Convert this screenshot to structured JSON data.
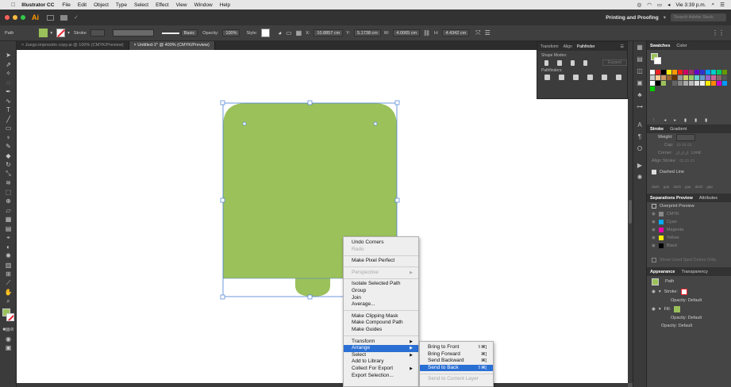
{
  "menubar": {
    "apple": "",
    "app_name": "Illustrator CC",
    "items": [
      "File",
      "Edit",
      "Object",
      "Type",
      "Select",
      "Effect",
      "View",
      "Window",
      "Help"
    ],
    "clock": "Vie 3:39 p.m."
  },
  "appbar": {
    "logo": "Ai",
    "workspace": "Printing and Proofing",
    "search_placeholder": "Search Adobe Stock"
  },
  "control_bar": {
    "selection_label": "Path",
    "stroke_label": "Stroke",
    "brush_label": "Basic",
    "opacity_label": "Opacity:",
    "opacity_value": "100%",
    "style_label": "Style:",
    "x_label": "X:",
    "x_value": "10.8857 cm",
    "y_label": "Y:",
    "y_value": "5.1738 cm",
    "w_label": "W:",
    "w_value": "4.0065 cm",
    "h_label": "H:",
    "h_value": "4.4342 cm",
    "fill_color": "#9bc15a"
  },
  "tabs": [
    {
      "label": "× Juego.impresión copy.ai @ 100% (CMYK/Preview)"
    },
    {
      "label": "× Untitled-1* @ 400% (CMYK/Preview)"
    }
  ],
  "pathfinder": {
    "tabs": [
      "Transform",
      "Align",
      "Pathfinder"
    ],
    "shape_modes_label": "Shape Modes:",
    "expand_label": "Expand",
    "pathfinders_label": "Pathfinders:"
  },
  "right_panel": {
    "swatches_tabs": [
      "Swatches",
      "Color"
    ],
    "stroke_tabs": [
      "Stroke",
      "Gradient"
    ],
    "weight_label": "Weight:",
    "cap_label": "Cap:",
    "corner_label": "Corner:",
    "limit_label": "Limit:",
    "align_stroke_label": "Align Stroke:",
    "dashed_line_label": "Dashed Line",
    "dash_labels": [
      "dash",
      "gap",
      "dash",
      "gap",
      "dash",
      "gap"
    ],
    "separations_tabs": [
      "Separations Preview",
      "Attributes"
    ],
    "overprint_label": "Overprint Preview",
    "plates": [
      "CMYK",
      "Cyan",
      "Magenta",
      "Yellow",
      "Black"
    ],
    "show_used_label": "Show Used Spot Colors Only",
    "appearance_tabs": [
      "Appearance",
      "Transparency"
    ],
    "path_label": "Path",
    "stroke_label": "Stroke:",
    "opacity_default": "Opacity: Default",
    "fill_label": "Fill:"
  },
  "context_menu": {
    "items": [
      {
        "label": "Undo Corners",
        "disabled": false,
        "arrow": false
      },
      {
        "label": "Redo",
        "disabled": true,
        "arrow": false
      },
      {
        "sep": true
      },
      {
        "label": "Make Pixel Perfect",
        "disabled": false,
        "arrow": false
      },
      {
        "sep": true
      },
      {
        "label": "Perspective",
        "disabled": true,
        "arrow": true
      },
      {
        "sep": true
      },
      {
        "label": "Isolate Selected Path",
        "disabled": false,
        "arrow": false
      },
      {
        "label": "Group",
        "disabled": false,
        "arrow": false
      },
      {
        "label": "Join",
        "disabled": false,
        "arrow": false
      },
      {
        "label": "Average...",
        "disabled": false,
        "arrow": false
      },
      {
        "sep": true
      },
      {
        "label": "Make Clipping Mask",
        "disabled": false,
        "arrow": false
      },
      {
        "label": "Make Compound Path",
        "disabled": false,
        "arrow": false
      },
      {
        "label": "Make Guides",
        "disabled": false,
        "arrow": false
      },
      {
        "sep": true
      },
      {
        "label": "Transform",
        "disabled": false,
        "arrow": true
      },
      {
        "label": "Arrange",
        "disabled": false,
        "arrow": true,
        "highlight": true
      },
      {
        "label": "Select",
        "disabled": false,
        "arrow": true
      },
      {
        "label": "Add to Library",
        "disabled": false,
        "arrow": false
      },
      {
        "label": "Collect For Export",
        "disabled": false,
        "arrow": true
      },
      {
        "label": "Export Selection...",
        "disabled": false,
        "arrow": false
      }
    ]
  },
  "submenu": {
    "items": [
      {
        "label": "Bring to Front",
        "shortcut": "⇧⌘]",
        "disabled": false
      },
      {
        "label": "Bring Forward",
        "shortcut": "⌘]",
        "disabled": false
      },
      {
        "label": "Send Backward",
        "shortcut": "⌘[",
        "disabled": false
      },
      {
        "label": "Send to Back",
        "shortcut": "⇧⌘[",
        "disabled": false,
        "highlight": true
      },
      {
        "sep": true
      },
      {
        "label": "Send to Current Layer",
        "shortcut": "",
        "disabled": true
      }
    ]
  },
  "colors": {
    "shape_fill": "#9bc15a",
    "selection": "#4a7fd6",
    "highlight": "#2a6fd4"
  },
  "icons": [
    "apple-icon",
    "wifi-icon",
    "battery-icon",
    "search-icon",
    "arrow-tool-icon",
    "direct-select-icon",
    "pen-icon",
    "type-icon",
    "brush-icon",
    "pencil-icon",
    "eraser-icon",
    "rotate-icon",
    "scale-icon",
    "graph-icon",
    "zoom-icon",
    "hand-icon"
  ]
}
